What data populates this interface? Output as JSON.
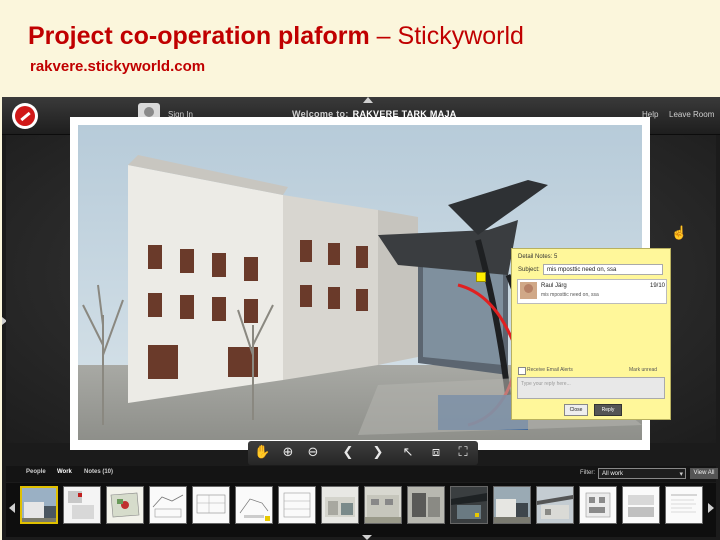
{
  "slide": {
    "title_bold": "Project co-operation plaform",
    "title_dash": "–",
    "title_brand": "Stickyworld",
    "subtitle": "rakvere.stickyworld.com"
  },
  "app": {
    "sign_in": "Sign In",
    "welcome_prefix": "Welcome to:",
    "room_name": "RAKVERE TARK MAJA",
    "help": "Help",
    "leave_room": "Leave Room"
  },
  "note": {
    "title": "Detail Notes: 5",
    "subject_label": "Subject:",
    "subject_value": "mis mposttic need on, ssa",
    "post_author": "Raul Järg",
    "post_date": "19/10",
    "post_text": "mis mposttic need on, ssa",
    "email_label": "Receive Email Alerts",
    "mark_unread": "Mark unread",
    "reply_placeholder": "Type your reply here...",
    "close_label": "Close",
    "reply_label": "Reply"
  },
  "toolbar": {
    "tools": [
      "hand-icon",
      "zoom-in-icon",
      "zoom-out-icon",
      "prev-arrow-icon",
      "next-arrow-icon",
      "pointer-icon",
      "crop-icon",
      "fullscreen-icon"
    ]
  },
  "tabs": {
    "people": "People",
    "work": "Work",
    "notes": "Notes (10)",
    "filter_label": "Filter:",
    "filter_value": "All work",
    "view_all": "View All"
  },
  "colors": {
    "slide_bg": "#fbf6dc",
    "slide_title": "#c00000",
    "note_bg": "#fff79a",
    "app_bg": "#1b1b1b"
  }
}
